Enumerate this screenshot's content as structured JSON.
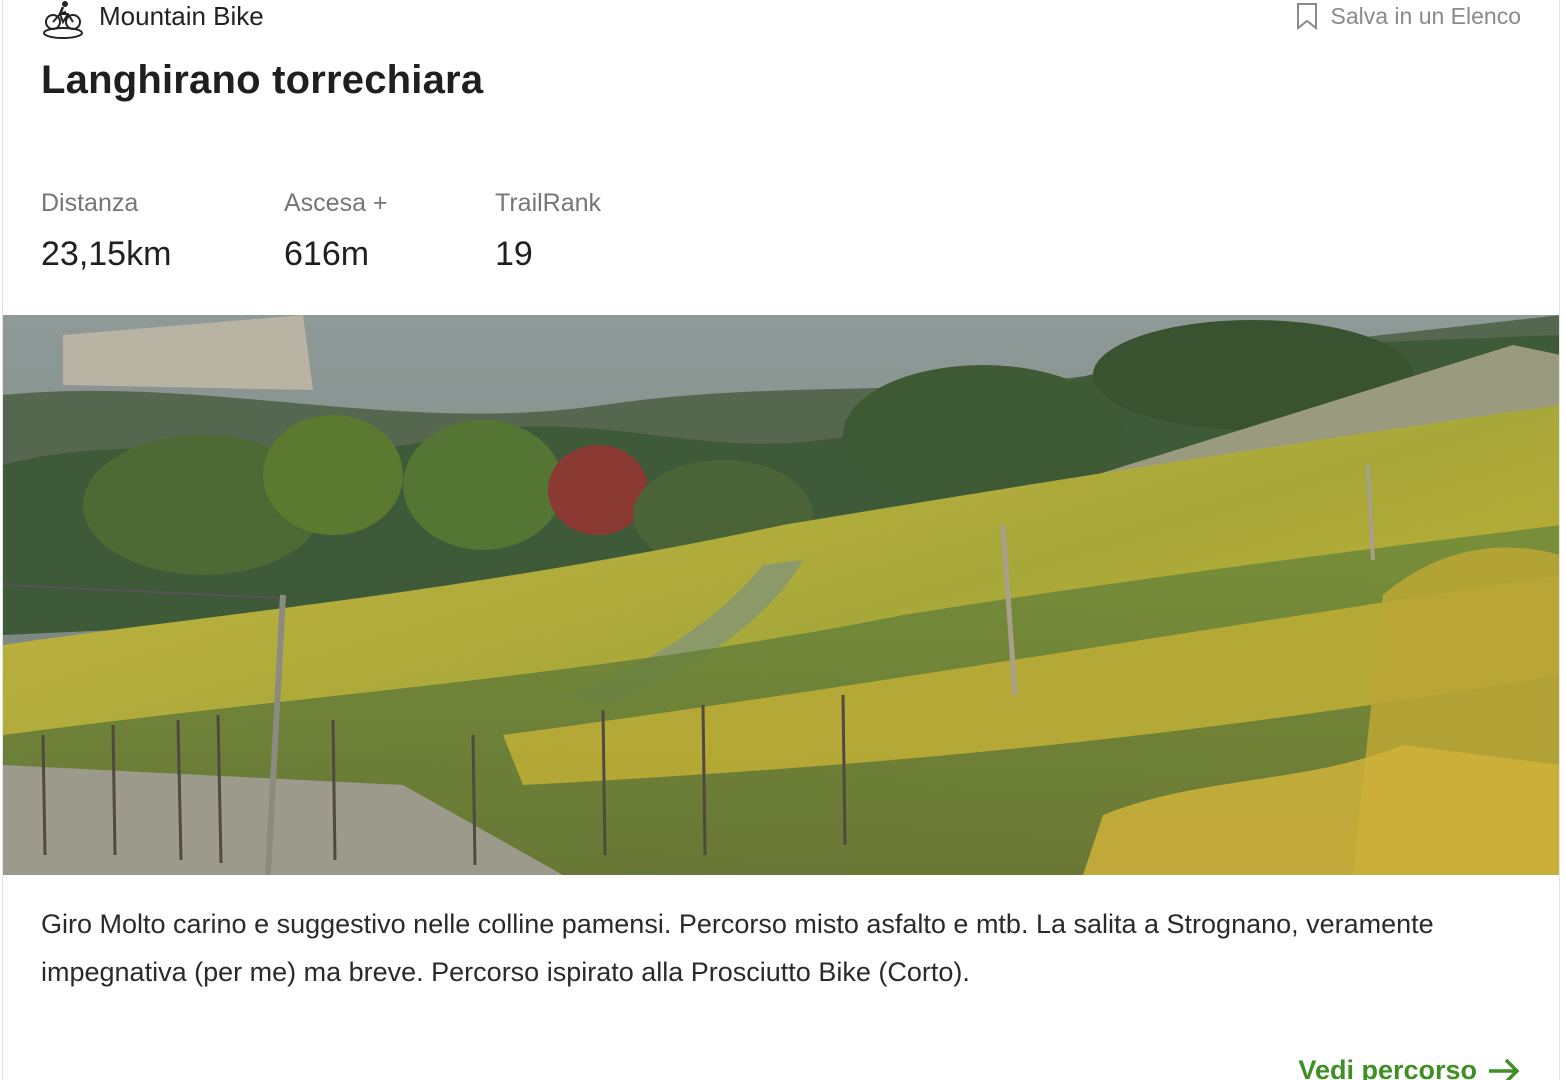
{
  "activity": {
    "label": "Mountain Bike",
    "icon": "mountain-bike-icon"
  },
  "save": {
    "label": "Salva in un Elenco",
    "icon": "bookmark-icon"
  },
  "trail": {
    "title": "Langhirano torrechiara",
    "stats": {
      "distance": {
        "label": "Distanza",
        "value": "23,15km"
      },
      "ascent": {
        "label": "Ascesa +",
        "value": "616m"
      },
      "trailrank": {
        "label": "TrailRank",
        "value": "19"
      }
    },
    "description": "Giro Molto carino e suggestivo nelle colline pamensi. Percorso misto asfalto e mtb. La salita a Strognano, veramente impegnativa (per me) ma breve. Percorso ispirato alla Prosciutto Bike (Corto)."
  },
  "cta": {
    "label": "Vedi percorso",
    "icon": "arrow-right-icon"
  },
  "colors": {
    "accent": "#3f8f25",
    "muted": "#767676"
  }
}
